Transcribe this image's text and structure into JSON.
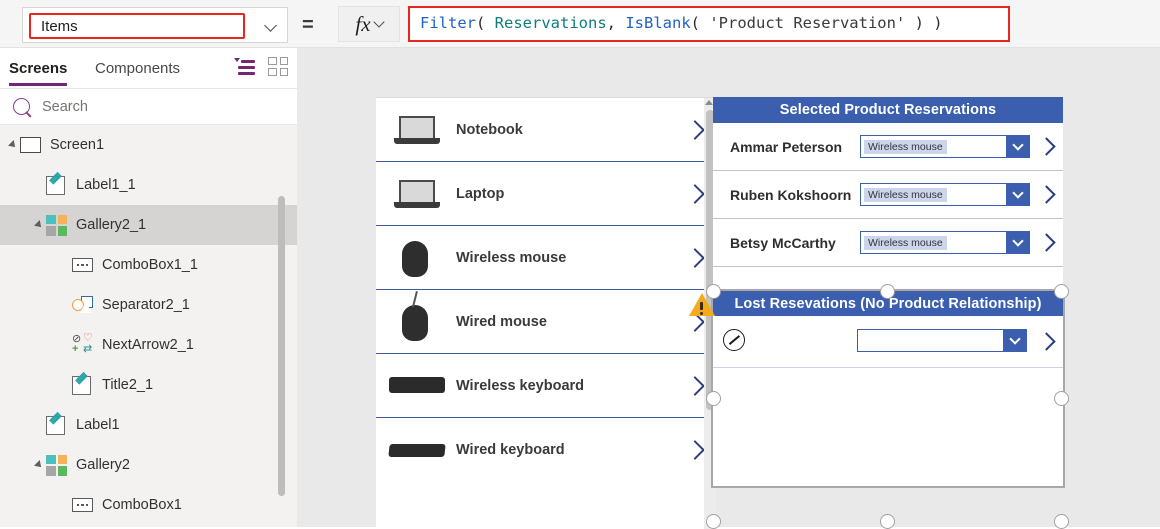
{
  "formula_bar": {
    "property_value": "Items",
    "equals_sign": "=",
    "fx_glyph": "fx",
    "formula_tokens": [
      {
        "text": "Filter",
        "kind": "function"
      },
      {
        "text": "( ",
        "kind": "plain"
      },
      {
        "text": "Reservations",
        "kind": "table"
      },
      {
        "text": ", ",
        "kind": "plain"
      },
      {
        "text": "IsBlank",
        "kind": "function"
      },
      {
        "text": "( ",
        "kind": "plain"
      },
      {
        "text": "'Product Reservation'",
        "kind": "string"
      },
      {
        "text": " ) )",
        "kind": "plain"
      }
    ],
    "formula_plain": "Filter( Reservations, IsBlank( 'Product Reservation' ) )"
  },
  "left_panel": {
    "tabs": [
      {
        "label": "Screens",
        "active": true
      },
      {
        "label": "Components",
        "active": false
      }
    ],
    "view_icons": [
      "tree-view-icon",
      "grid-view-icon"
    ],
    "search": {
      "placeholder": "Search",
      "value": ""
    },
    "tree": [
      {
        "label": "Screen1",
        "icon": "screen-icon",
        "depth": 0,
        "expandable": true,
        "selected": false
      },
      {
        "label": "Label1_1",
        "icon": "label-icon",
        "depth": 1,
        "expandable": false,
        "selected": false
      },
      {
        "label": "Gallery2_1",
        "icon": "gallery-icon",
        "depth": 1,
        "expandable": true,
        "selected": true
      },
      {
        "label": "ComboBox1_1",
        "icon": "combobox-icon",
        "depth": 2,
        "expandable": false,
        "selected": false
      },
      {
        "label": "Separator2_1",
        "icon": "separator-icon",
        "depth": 2,
        "expandable": false,
        "selected": false
      },
      {
        "label": "NextArrow2_1",
        "icon": "nextarrow-icon",
        "depth": 2,
        "expandable": false,
        "selected": false
      },
      {
        "label": "Title2_1",
        "icon": "label-icon",
        "depth": 2,
        "expandable": false,
        "selected": false
      },
      {
        "label": "Label1",
        "icon": "label-icon",
        "depth": 1,
        "expandable": false,
        "selected": false
      },
      {
        "label": "Gallery2",
        "icon": "gallery-icon",
        "depth": 1,
        "expandable": true,
        "selected": false
      },
      {
        "label": "ComboBox1",
        "icon": "combobox-icon",
        "depth": 2,
        "expandable": false,
        "selected": false
      }
    ]
  },
  "canvas": {
    "product_gallery": {
      "name": "product-list-gallery",
      "items": [
        {
          "label": "Notebook",
          "image": "laptop-image"
        },
        {
          "label": "Laptop",
          "image": "laptop-image"
        },
        {
          "label": "Wireless mouse",
          "image": "mouse-image"
        },
        {
          "label": "Wired mouse",
          "image": "wired-mouse-image"
        },
        {
          "label": "Wireless keyboard",
          "image": "keyboard-image"
        },
        {
          "label": "Wired keyboard",
          "image": "wired-keyboard-image"
        }
      ]
    },
    "selected_reservations": {
      "header": "Selected Product Reservations",
      "rows": [
        {
          "name": "Ammar Peterson",
          "combo_value": "Wireless mouse"
        },
        {
          "name": "Ruben Kokshoorn",
          "combo_value": "Wireless mouse"
        },
        {
          "name": "Betsy McCarthy",
          "combo_value": "Wireless mouse"
        }
      ]
    },
    "lost_reservations": {
      "header": "Lost Resevations (No Product Relationship)",
      "rows": [
        {
          "name": "",
          "combo_value": ""
        }
      ],
      "selected": true,
      "warning_icon": "warning-triangle-icon",
      "edit_icon": "edit-pencil-icon"
    }
  },
  "colors": {
    "accent_purple": "#742774",
    "header_blue": "#3b5fae",
    "formula_highlight_red": "#e8251e",
    "warning_amber": "#f2ab1d",
    "chevron_navy": "#2b3f82"
  }
}
